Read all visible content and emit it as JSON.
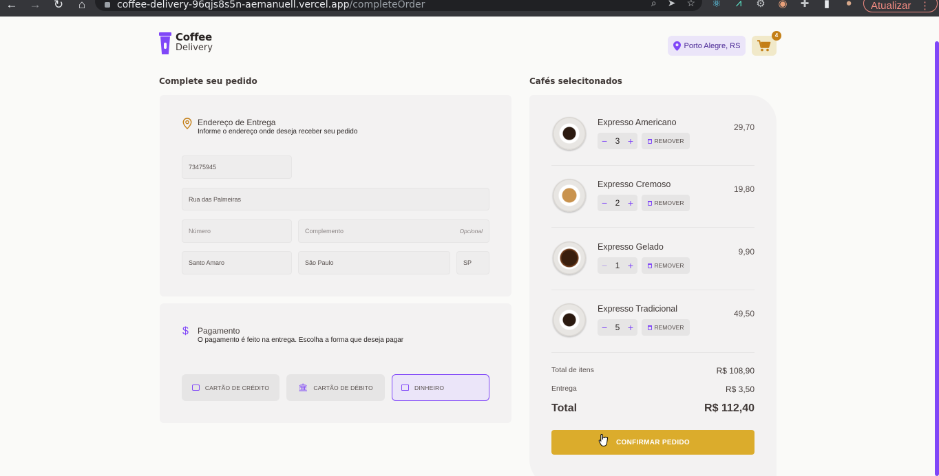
{
  "browser": {
    "url_host": "coffee-delivery-96qjs8s5n-aemanuell.vercel.app",
    "url_path": "/completeOrder",
    "update_button": "Atualizar"
  },
  "header": {
    "logo_line1": "Coffee",
    "logo_line2": "Delivery",
    "location": "Porto Alegre, RS",
    "cart_count": "4"
  },
  "order_form": {
    "section_title": "Complete seu pedido",
    "address": {
      "title": "Endereço de Entrega",
      "subtitle": "Informe o endereço onde deseja receber seu pedido",
      "cep": "73475945",
      "rua": "Rua das Palmeiras",
      "numero_placeholder": "Número",
      "complemento_placeholder": "Complemento",
      "complemento_hint": "Opcional",
      "bairro": "Santo Amaro",
      "cidade": "São Paulo",
      "uf": "SP"
    },
    "payment": {
      "title": "Pagamento",
      "subtitle": "O pagamento é feito na entrega. Escolha a forma que deseja pagar",
      "options": [
        "CARTÃO DE CRÉDITO",
        "CARTÃO DE DÉBITO",
        "DINHEIRO"
      ],
      "selected": "DINHEIRO"
    }
  },
  "cart": {
    "section_title": "Cafés selecitonados",
    "remove_label": "REMOVER",
    "items": [
      {
        "name": "Expresso Americano",
        "qty": "3",
        "price": "29,70"
      },
      {
        "name": "Expresso Cremoso",
        "qty": "2",
        "price": "19,80"
      },
      {
        "name": "Expresso Gelado",
        "qty": "1",
        "price": "9,90"
      },
      {
        "name": "Expresso Tradicional",
        "qty": "5",
        "price": "49,50"
      }
    ],
    "totals": {
      "items_label": "Total de itens",
      "items_value": "R$ 108,90",
      "delivery_label": "Entrega",
      "delivery_value": "R$ 3,50",
      "total_label": "Total",
      "total_value": "R$ 112,40"
    },
    "confirm_label": "CONFIRMAR PEDIDO"
  },
  "colors": {
    "purple": "#8047f8",
    "purple_light": "#ebe5f9",
    "yellow": "#dbac2c",
    "yellow_dark": "#c47f17",
    "yellow_light": "#f1e9c9"
  }
}
